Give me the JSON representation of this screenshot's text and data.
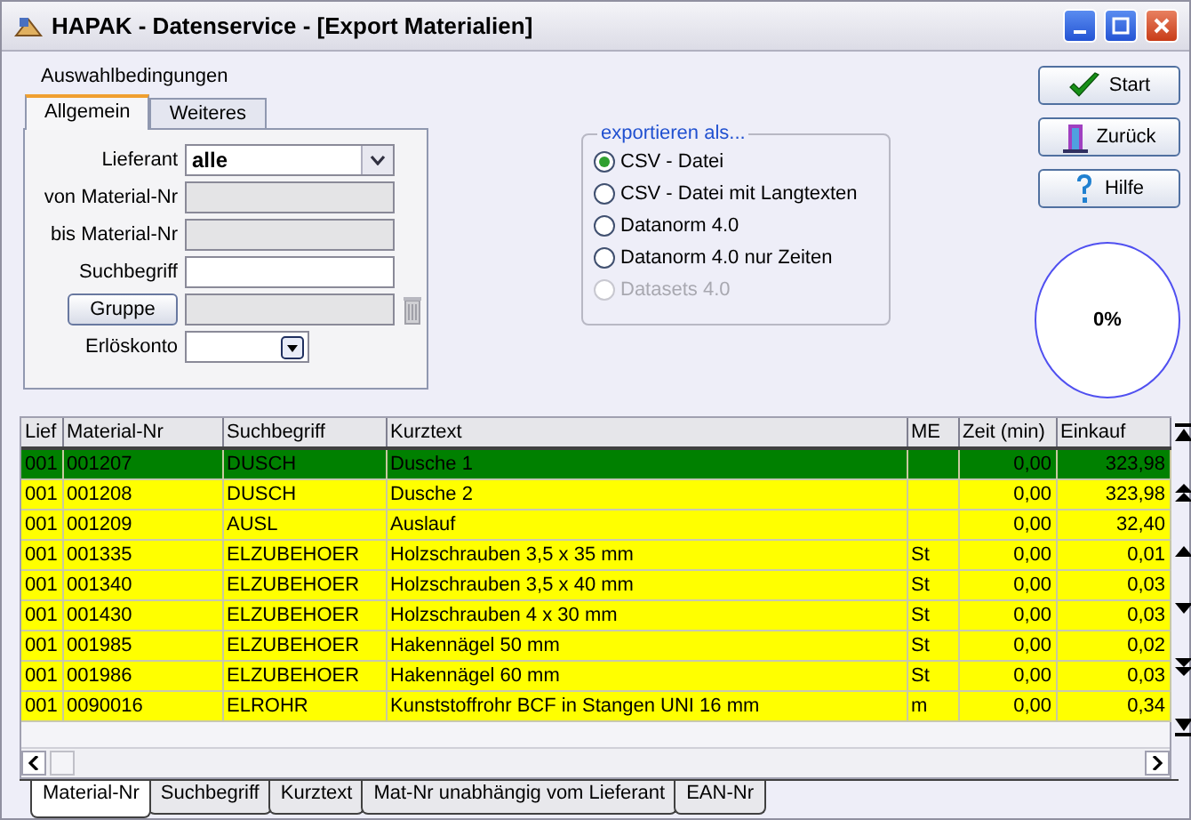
{
  "window": {
    "title": "HAPAK - Datenservice - [Export Materialien]"
  },
  "filter": {
    "title": "Auswahlbedingungen",
    "tabs": [
      {
        "label": "Allgemein",
        "selected": true
      },
      {
        "label": "Weiteres",
        "selected": false
      }
    ],
    "fields": [
      {
        "kind": "dropdown",
        "label": "Lieferant",
        "value": "alle"
      },
      {
        "kind": "readonly",
        "label": "von Material-Nr"
      },
      {
        "kind": "readonly",
        "label": "bis Material-Nr"
      },
      {
        "kind": "text",
        "label": "Suchbegriff"
      },
      {
        "kind": "group",
        "label": "Gruppe"
      },
      {
        "kind": "combo",
        "label": "Erlöskonto"
      }
    ]
  },
  "export": {
    "title": "exportieren als...",
    "options": [
      {
        "label": "CSV - Datei",
        "selected": true,
        "disabled": false
      },
      {
        "label": "CSV - Datei mit Langtexten",
        "selected": false,
        "disabled": false
      },
      {
        "label": "Datanorm 4.0",
        "selected": false,
        "disabled": false
      },
      {
        "label": "Datanorm 4.0 nur Zeiten",
        "selected": false,
        "disabled": false
      },
      {
        "label": "Datasets 4.0",
        "selected": false,
        "disabled": true
      }
    ]
  },
  "buttons": [
    {
      "kind": "start",
      "label": "Start"
    },
    {
      "kind": "back",
      "label": "Zurück"
    },
    {
      "kind": "help",
      "label": "Hilfe"
    }
  ],
  "progress": {
    "text": "0%"
  },
  "grid": {
    "columns": [
      "Lief",
      "Material-Nr",
      "Suchbegriff",
      "Kurztext",
      "ME",
      "Zeit (min)",
      "Einkauf"
    ],
    "rows": [
      {
        "selected": true,
        "cells": [
          "001",
          "001207",
          "DUSCH",
          "Dusche 1",
          "",
          "0,00",
          "323,98"
        ]
      },
      {
        "selected": false,
        "cells": [
          "001",
          "001208",
          "DUSCH",
          "Dusche 2",
          "",
          "0,00",
          "323,98"
        ]
      },
      {
        "selected": false,
        "cells": [
          "001",
          "001209",
          "AUSL",
          "Auslauf",
          "",
          "0,00",
          "32,40"
        ]
      },
      {
        "selected": false,
        "cells": [
          "001",
          "001335",
          "ELZUBEHOER",
          "Holzschrauben 3,5 x 35 mm",
          "St",
          "0,00",
          "0,01"
        ]
      },
      {
        "selected": false,
        "cells": [
          "001",
          "001340",
          "ELZUBEHOER",
          "Holzschrauben 3,5 x 40 mm",
          "St",
          "0,00",
          "0,03"
        ]
      },
      {
        "selected": false,
        "cells": [
          "001",
          "001430",
          "ELZUBEHOER",
          "Holzschrauben 4 x 30 mm",
          "St",
          "0,00",
          "0,03"
        ]
      },
      {
        "selected": false,
        "cells": [
          "001",
          "001985",
          "ELZUBEHOER",
          "Hakennägel 50 mm",
          "St",
          "0,00",
          "0,02"
        ]
      },
      {
        "selected": false,
        "cells": [
          "001",
          "001986",
          "ELZUBEHOER",
          "Hakennägel 60 mm",
          "St",
          "0,00",
          "0,03"
        ]
      },
      {
        "selected": false,
        "cells": [
          "001",
          "0090016",
          "ELROHR",
          "Kunststoffrohr BCF in Stangen UNI 16 mm",
          "m",
          "0,00",
          "0,34"
        ]
      }
    ]
  },
  "sort_tabs": [
    {
      "label": "Material-Nr",
      "selected": true
    },
    {
      "label": "Suchbegriff",
      "selected": false
    },
    {
      "label": "Kurztext",
      "selected": false
    },
    {
      "label": "Mat-Nr unabhängig vom Lieferant",
      "selected": false
    },
    {
      "label": "EAN-Nr",
      "selected": false
    }
  ]
}
